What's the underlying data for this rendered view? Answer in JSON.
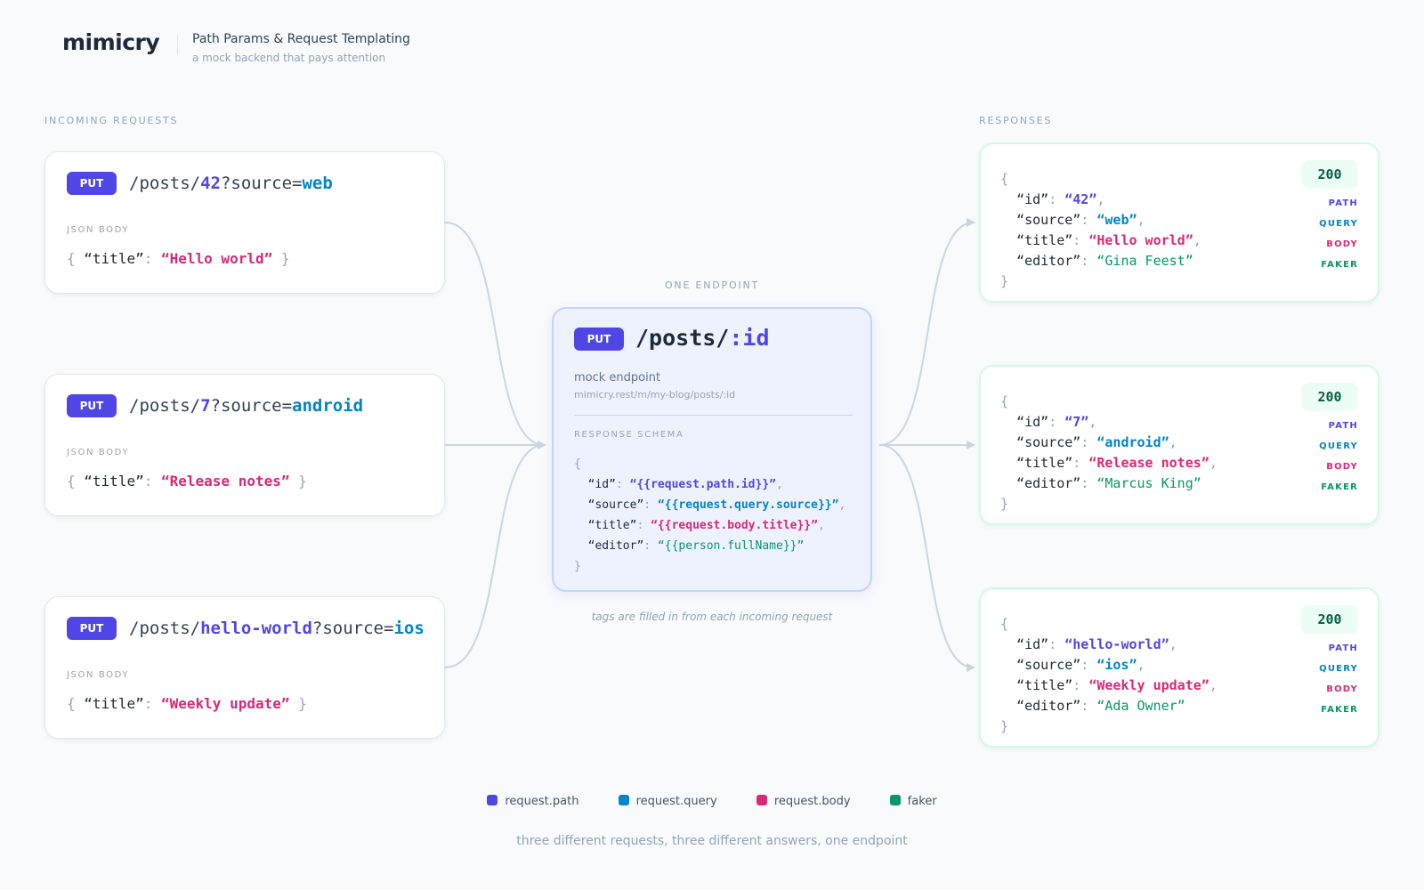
{
  "header": {
    "logo": "mimicry",
    "title": "Path Params & Request Templating",
    "subtitle": "a mock backend that pays attention"
  },
  "sections": {
    "incoming": "INCOMING REQUESTS",
    "endpoint": "ONE ENDPOINT",
    "responses": "RESPONSES"
  },
  "requests": [
    {
      "method": "PUT",
      "path_prefix": "/posts/",
      "path_param": "42",
      "query_prefix": "?source=",
      "query_value": "web",
      "body_label": "JSON BODY",
      "body_open": "{",
      "body_key": "“title”",
      "body_colon": ":",
      "body_value": "“Hello world”",
      "body_close": "}"
    },
    {
      "method": "PUT",
      "path_prefix": "/posts/",
      "path_param": "7",
      "query_prefix": "?source=",
      "query_value": "android",
      "body_label": "JSON BODY",
      "body_open": "{",
      "body_key": "“title”",
      "body_colon": ":",
      "body_value": "“Release notes”",
      "body_close": "}"
    },
    {
      "method": "PUT",
      "path_prefix": "/posts/",
      "path_param": "hello-world",
      "query_prefix": "?source=",
      "query_value": "ios",
      "body_label": "JSON BODY",
      "body_open": "{",
      "body_key": "“title”",
      "body_colon": ":",
      "body_value": "“Weekly update”",
      "body_close": "}"
    }
  ],
  "endpoint": {
    "method": "PUT",
    "path_prefix": "/posts/",
    "path_param": ":id",
    "label": "mock endpoint",
    "url": "mimicry.rest/m/my-blog/posts/:id",
    "schema_label": "RESPONSE SCHEMA",
    "schema_open": "{",
    "schema_close": "}",
    "schema": [
      {
        "key": "“id”",
        "value": "“{{request.path.id}}”",
        "comma": ","
      },
      {
        "key": "“source”",
        "value": "“{{request.query.source}}”",
        "comma": ","
      },
      {
        "key": "“title”",
        "value": "“{{request.body.title}}”",
        "comma": ","
      },
      {
        "key": "“editor”",
        "value": "“{{person.fullName}}”",
        "comma": ""
      }
    ],
    "caption": "tags are filled in from each incoming request"
  },
  "responses": [
    {
      "status": "200",
      "open": "{",
      "close": "}",
      "fields": [
        {
          "key": "“id”",
          "value": "“42”",
          "comma": ",",
          "tag": "PATH"
        },
        {
          "key": "“source”",
          "value": "“web”",
          "comma": ",",
          "tag": "QUERY"
        },
        {
          "key": "“title”",
          "value": "“Hello world”",
          "comma": ",",
          "tag": "BODY"
        },
        {
          "key": "“editor”",
          "value": "“Gina Feest”",
          "comma": "",
          "tag": "FAKER"
        }
      ]
    },
    {
      "status": "200",
      "open": "{",
      "close": "}",
      "fields": [
        {
          "key": "“id”",
          "value": "“7”",
          "comma": ",",
          "tag": "PATH"
        },
        {
          "key": "“source”",
          "value": "“android”",
          "comma": ",",
          "tag": "QUERY"
        },
        {
          "key": "“title”",
          "value": "“Release notes”",
          "comma": ",",
          "tag": "BODY"
        },
        {
          "key": "“editor”",
          "value": "“Marcus King”",
          "comma": "",
          "tag": "FAKER"
        }
      ]
    },
    {
      "status": "200",
      "open": "{",
      "close": "}",
      "fields": [
        {
          "key": "“id”",
          "value": "“hello-world”",
          "comma": ",",
          "tag": "PATH"
        },
        {
          "key": "“source”",
          "value": "“ios”",
          "comma": ",",
          "tag": "QUERY"
        },
        {
          "key": "“title”",
          "value": "“Weekly update”",
          "comma": ",",
          "tag": "BODY"
        },
        {
          "key": "“editor”",
          "value": "“Ada Owner”",
          "comma": "",
          "tag": "FAKER"
        }
      ]
    }
  ],
  "legend": [
    {
      "label": "request.path",
      "color": "#4f46e5"
    },
    {
      "label": "request.query",
      "color": "#0284c7"
    },
    {
      "label": "request.body",
      "color": "#db2777"
    },
    {
      "label": "faker",
      "color": "#059669"
    }
  ],
  "footer": "three different requests, three different answers, one endpoint",
  "colors": {
    "path": "#4f46e5",
    "query": "#0284c7",
    "body": "#db2777",
    "faker": "#059669",
    "connector": "#cbd5e1"
  }
}
